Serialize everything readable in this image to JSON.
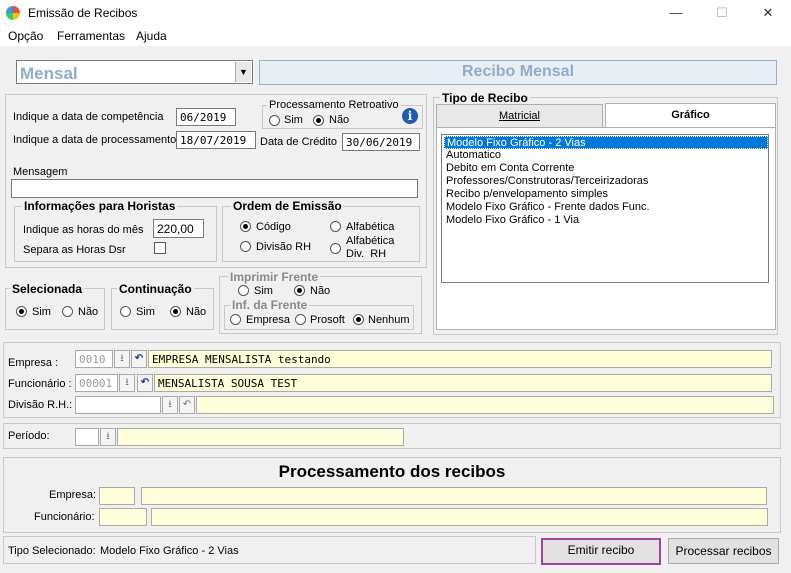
{
  "window": {
    "title": "Emissão de Recibos",
    "minimize": "—",
    "maximize": "☐",
    "close": "✕"
  },
  "menu": [
    "Opção",
    "Ferramentas",
    "Ajuda"
  ],
  "header": {
    "type_value": "Mensal",
    "banner": "Recibo Mensal"
  },
  "dates": {
    "competencia_label": "Indique a data de competência",
    "competencia_value": "06/2019",
    "processamento_label": "Indique a data de processamento",
    "processamento_value": "18/07/2019",
    "credito_label": "Data de Crédito",
    "credito_value": "30/06/2019"
  },
  "retroativo": {
    "title": "Processamento Retroativo",
    "sim": "Sim",
    "nao": "Não",
    "selected": "nao"
  },
  "mensagem": {
    "label": "Mensagem",
    "value": ""
  },
  "horistas": {
    "title": "Informações para Horistas",
    "horas_label": "Indique as horas do mês",
    "horas_value": "220,00",
    "dsr_label": "Separa as Horas Dsr"
  },
  "ordem": {
    "title": "Ordem de Emissão",
    "codigo": "Código",
    "alfabetica": "Alfabética",
    "divisao": "Divisão RH",
    "alfabetica_div1": "Alfabética",
    "alfabetica_div2": "Div.  RH",
    "selected": "codigo"
  },
  "selecionada": {
    "title": "Selecionada",
    "sim": "Sim",
    "nao": "Não",
    "selected": "sim"
  },
  "continuacao": {
    "title": "Continuação",
    "sim": "Sim",
    "nao": "Não",
    "selected": "nao"
  },
  "imprimir_frente": {
    "title": "Imprimir Frente",
    "sim": "Sim",
    "nao": "Não",
    "selected": "nao",
    "inf_title": "Inf. da Frente",
    "empresa": "Empresa",
    "prosoft": "Prosoft",
    "nenhum": "Nenhum",
    "inf_selected": "nenhum"
  },
  "tipo_recibo": {
    "title": "Tipo de Recibo",
    "tabs": [
      "Matricial",
      "Gráfico"
    ],
    "active_tab": 1,
    "items": [
      "Modelo Fixo Gráfico - 2 Vias",
      "Automatico",
      "Debito em Conta Corrente",
      "Professores/Construtoras/Terceirizadoras",
      "Recibo p/envelopamento simples",
      "Modelo Fixo Gráfico - Frente dados Func.",
      "Modelo Fixo Gráfico - 1 Via"
    ],
    "selected_index": 0
  },
  "filters": {
    "empresa_label": "Empresa :",
    "empresa_code": "0010",
    "empresa_name": "EMPRESA MENSALISTA testando",
    "funcionario_label": "Funcionário :",
    "funcionario_code": "00001",
    "funcionario_name": "MENSALISTA SOUSA TEST",
    "divisao_label": "Divisão R.H.:",
    "divisao_code": "",
    "divisao_name": ""
  },
  "periodo": {
    "label": "Período:",
    "code": "",
    "value": ""
  },
  "processamento": {
    "title": "Processamento dos recibos",
    "empresa_label": "Empresa:",
    "funcionario_label": "Funcionário:"
  },
  "status": {
    "label": "Tipo Selecionado:",
    "value": "Modelo Fixo Gráfico - 2 Vias"
  },
  "buttons": {
    "emitir": "Emitir recibo",
    "processar": "Processar recibos"
  },
  "icons": {
    "info": "i",
    "down_arrow": "⭳",
    "undo": "↶",
    "combo_arrow": "▼",
    "dsr_checked": false
  }
}
